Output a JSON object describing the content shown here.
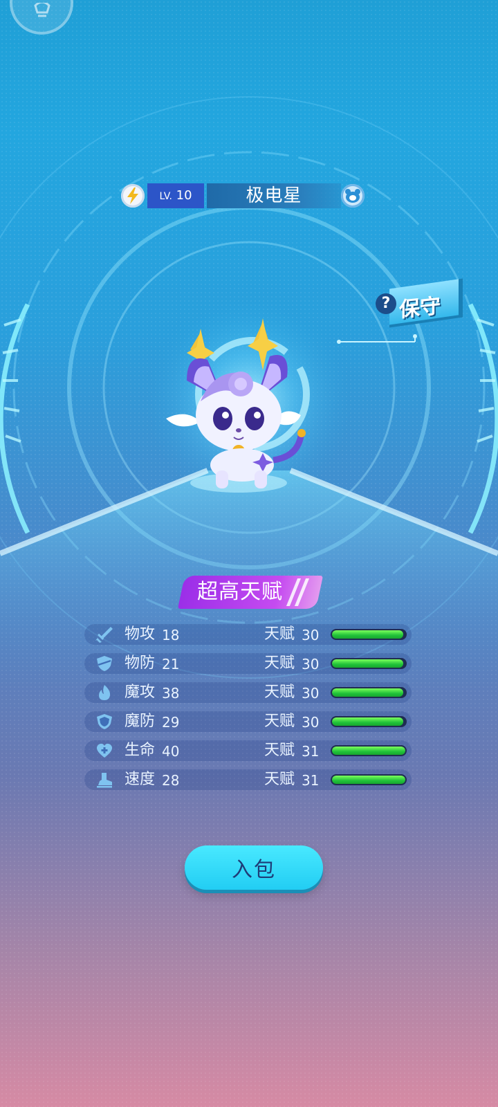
{
  "pet": {
    "level_prefix": "LV.",
    "level": "10",
    "name": "极电星",
    "nature": "保守",
    "nature_help": "?"
  },
  "talent_banner": "超高天赋",
  "talent_label": "天赋",
  "stats": [
    {
      "icon": "sword-icon",
      "name": "物攻",
      "value": "18",
      "talent": "30",
      "talent_fill": 0.97
    },
    {
      "icon": "shield-icon",
      "name": "物防",
      "value": "21",
      "talent": "30",
      "talent_fill": 0.97
    },
    {
      "icon": "flame-icon",
      "name": "魔攻",
      "value": "38",
      "talent": "30",
      "talent_fill": 0.97
    },
    {
      "icon": "magic-shield-icon",
      "name": "魔防",
      "value": "29",
      "talent": "30",
      "talent_fill": 0.97
    },
    {
      "icon": "heart-plus-icon",
      "name": "生命",
      "value": "40",
      "talent": "31",
      "talent_fill": 1.0
    },
    {
      "icon": "boot-icon",
      "name": "速度",
      "value": "28",
      "talent": "31",
      "talent_fill": 1.0
    }
  ],
  "bag_button": "入包",
  "colors": {
    "level_bg": "#2c55c8",
    "banner": "#b03cec",
    "bar_fill": "#21c23a",
    "button": "#2fd8f8"
  }
}
